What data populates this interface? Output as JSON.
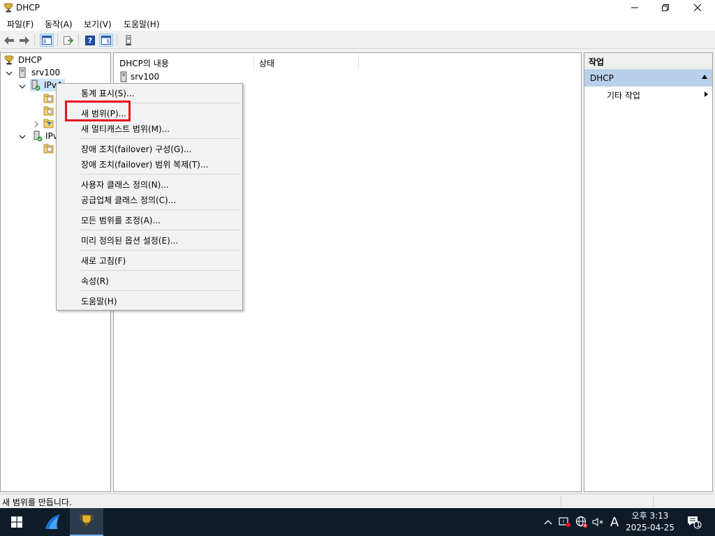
{
  "window": {
    "title": "DHCP"
  },
  "menubar": {
    "items": [
      "파일(F)",
      "동작(A)",
      "보기(V)",
      "도움말(H)"
    ]
  },
  "toolbar": {
    "icons": [
      "back-arrow-icon",
      "forward-arrow-icon",
      "show-hide-console-tree-icon",
      "export-list-icon",
      "help-icon",
      "show-hide-action-pane-icon",
      "server-status-icon"
    ]
  },
  "tree": {
    "root": "DHCP",
    "server": "srv100",
    "ipv4": "IPv4",
    "ipv6": "IPv6"
  },
  "list": {
    "columns": [
      "DHCP의 내용",
      "상태"
    ],
    "rows": [
      {
        "name": "srv100",
        "status": ""
      }
    ]
  },
  "actions": {
    "header": "작업",
    "section": "DHCP",
    "items": [
      "기타 작업"
    ]
  },
  "context_menu": {
    "items": [
      "통계 표시(S)...",
      "새 범위(P)...",
      "새 멀티캐스트 범위(M)...",
      "장애 조치(failover) 구성(G)...",
      "장애 조치(failover) 범위 복제(T)...",
      "사용자 클래스 정의(N)...",
      "공급업체 클래스 정의(C)...",
      "모든 범위를 조정(A)...",
      "미리 정의된 옵션 설정(E)...",
      "새로 고침(F)",
      "속성(R)",
      "도움말(H)"
    ],
    "highlighted": "새 범위(P)..."
  },
  "statusbar": {
    "text": "새 범위를 만듭니다."
  },
  "taskbar": {
    "ime_indicator": "A",
    "clock_time": "오후 3:13",
    "clock_date": "2025-04-25",
    "notification_count": "1"
  },
  "colors": {
    "highlight_box": "#e81123",
    "action_section_bg": "#b8d0ea",
    "taskbar_bg": "#101b2a"
  }
}
